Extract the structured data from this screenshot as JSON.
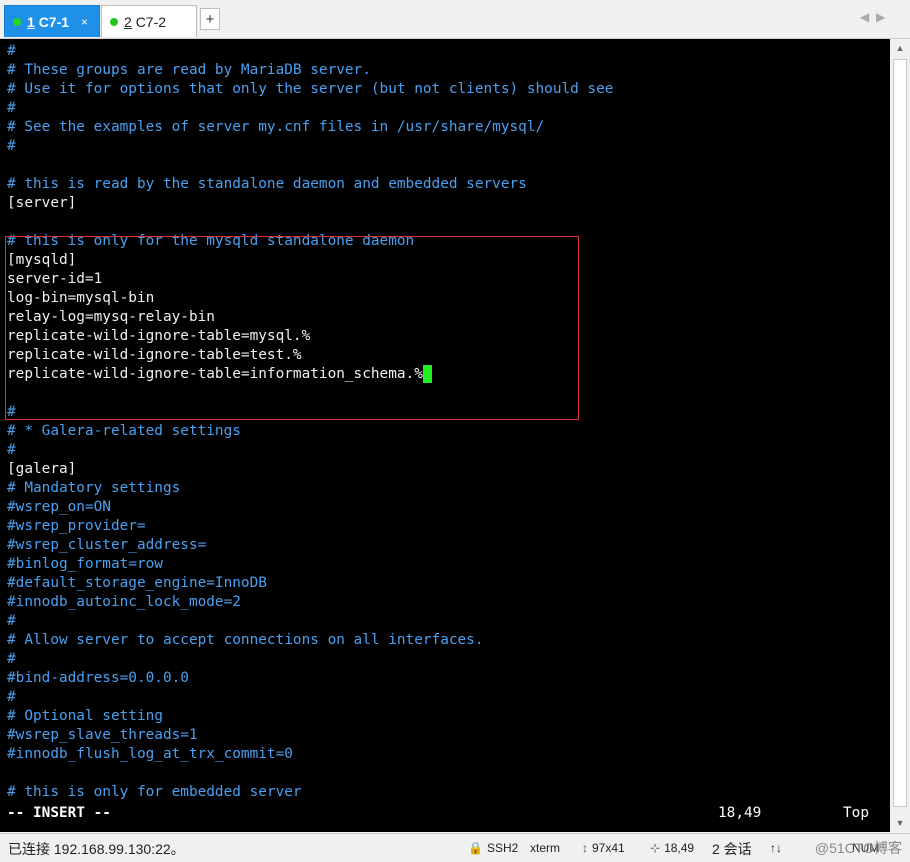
{
  "tabs": [
    {
      "index": "1",
      "label": "C7-1",
      "close": "×"
    },
    {
      "index": "2",
      "label": "C7-2"
    }
  ],
  "tab_add": "+",
  "tab_nav": {
    "prev": "◀",
    "next": "▶"
  },
  "terminal": {
    "lines": [
      {
        "text": "#",
        "kind": "comment"
      },
      {
        "text": "# These groups are read by MariaDB server.",
        "kind": "comment"
      },
      {
        "text": "# Use it for options that only the server (but not clients) should see",
        "kind": "comment"
      },
      {
        "text": "#",
        "kind": "comment"
      },
      {
        "text": "# See the examples of server my.cnf files in /usr/share/mysql/",
        "kind": "comment"
      },
      {
        "text": "#",
        "kind": "comment"
      },
      {
        "text": "",
        "kind": "plain"
      },
      {
        "text": "# this is read by the standalone daemon and embedded servers",
        "kind": "comment"
      },
      {
        "text": "[server]",
        "kind": "plain"
      },
      {
        "text": "",
        "kind": "plain"
      },
      {
        "text": "# this is only for the mysqld standalone daemon",
        "kind": "comment"
      },
      {
        "text": "[mysqld]",
        "kind": "plain"
      },
      {
        "text": "server-id=1",
        "kind": "plain"
      },
      {
        "text": "log-bin=mysql-bin",
        "kind": "plain"
      },
      {
        "text": "relay-log=mysq-relay-bin",
        "kind": "plain"
      },
      {
        "text": "replicate-wild-ignore-table=mysql.%",
        "kind": "plain"
      },
      {
        "text": "replicate-wild-ignore-table=test.%",
        "kind": "plain"
      },
      {
        "text": "replicate-wild-ignore-table=information_schema.%",
        "kind": "plain",
        "cursor": true
      },
      {
        "text": "",
        "kind": "plain"
      },
      {
        "text": "#",
        "kind": "comment"
      },
      {
        "text": "# * Galera-related settings",
        "kind": "comment"
      },
      {
        "text": "#",
        "kind": "comment"
      },
      {
        "text": "[galera]",
        "kind": "plain"
      },
      {
        "text": "# Mandatory settings",
        "kind": "comment"
      },
      {
        "text": "#wsrep_on=ON",
        "kind": "comment"
      },
      {
        "text": "#wsrep_provider=",
        "kind": "comment"
      },
      {
        "text": "#wsrep_cluster_address=",
        "kind": "comment"
      },
      {
        "text": "#binlog_format=row",
        "kind": "comment"
      },
      {
        "text": "#default_storage_engine=InnoDB",
        "kind": "comment"
      },
      {
        "text": "#innodb_autoinc_lock_mode=2",
        "kind": "comment"
      },
      {
        "text": "#",
        "kind": "comment"
      },
      {
        "text": "# Allow server to accept connections on all interfaces.",
        "kind": "comment"
      },
      {
        "text": "#",
        "kind": "comment"
      },
      {
        "text": "#bind-address=0.0.0.0",
        "kind": "comment"
      },
      {
        "text": "#",
        "kind": "comment"
      },
      {
        "text": "# Optional setting",
        "kind": "comment"
      },
      {
        "text": "#wsrep_slave_threads=1",
        "kind": "comment"
      },
      {
        "text": "#innodb_flush_log_at_trx_commit=0",
        "kind": "comment"
      },
      {
        "text": "",
        "kind": "plain"
      },
      {
        "text": "# this is only for embedded server",
        "kind": "comment"
      }
    ],
    "mode": "-- INSERT --",
    "position": "18,49",
    "scroll_pos": "Top",
    "colors": {
      "comment": "#4aa0f0",
      "plain": "#f0f0f0",
      "cursor": "#22ee22",
      "highlight": "#e03030"
    }
  },
  "statusbar": {
    "connection": "已连接 192.168.99.130:22。",
    "protocol": "SSH2",
    "term": "xterm",
    "size": "97x41",
    "cursor_pos": "18,49",
    "sessions": "2 会话",
    "watermark": "@51CTO博客",
    "num": "NUM"
  }
}
